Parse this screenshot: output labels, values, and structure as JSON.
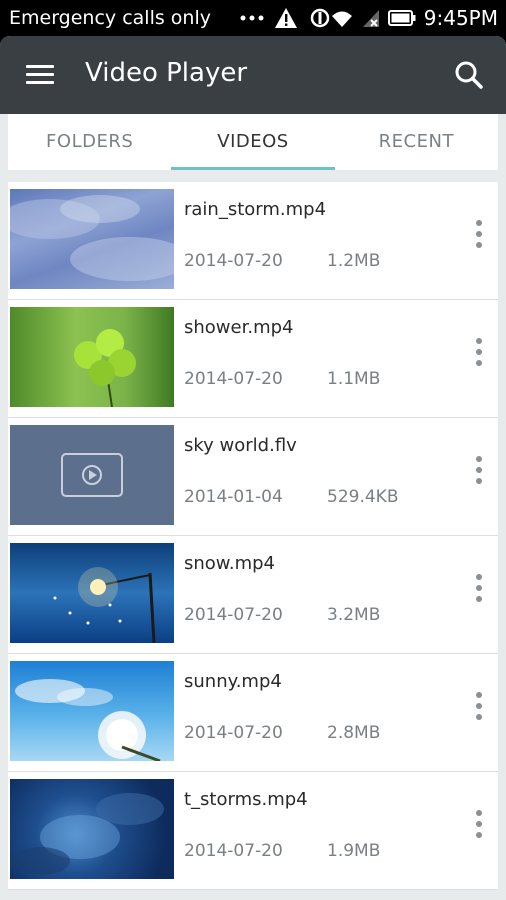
{
  "status_bar": {
    "carrier": "Emergency calls only",
    "time": "9:45PM"
  },
  "toolbar": {
    "title": "Video Player"
  },
  "tabs": [
    {
      "label": "FOLDERS",
      "active": false
    },
    {
      "label": "VIDEOS",
      "active": true
    },
    {
      "label": "RECENT",
      "active": false
    }
  ],
  "videos": [
    {
      "name": "rain_storm.mp4",
      "date": "2014-07-20",
      "size": "1.2MB"
    },
    {
      "name": "shower.mp4",
      "date": "2014-07-20",
      "size": "1.1MB"
    },
    {
      "name": "sky world.flv",
      "date": "2014-01-04",
      "size": "529.4KB"
    },
    {
      "name": "snow.mp4",
      "date": "2014-07-20",
      "size": "3.2MB"
    },
    {
      "name": "sunny.mp4",
      "date": "2014-07-20",
      "size": "2.8MB"
    },
    {
      "name": "t_storms.mp4",
      "date": "2014-07-20",
      "size": "1.9MB"
    }
  ],
  "colors": {
    "toolbar": "#3a3f44",
    "tab_indicator": "#6ec1c8"
  }
}
